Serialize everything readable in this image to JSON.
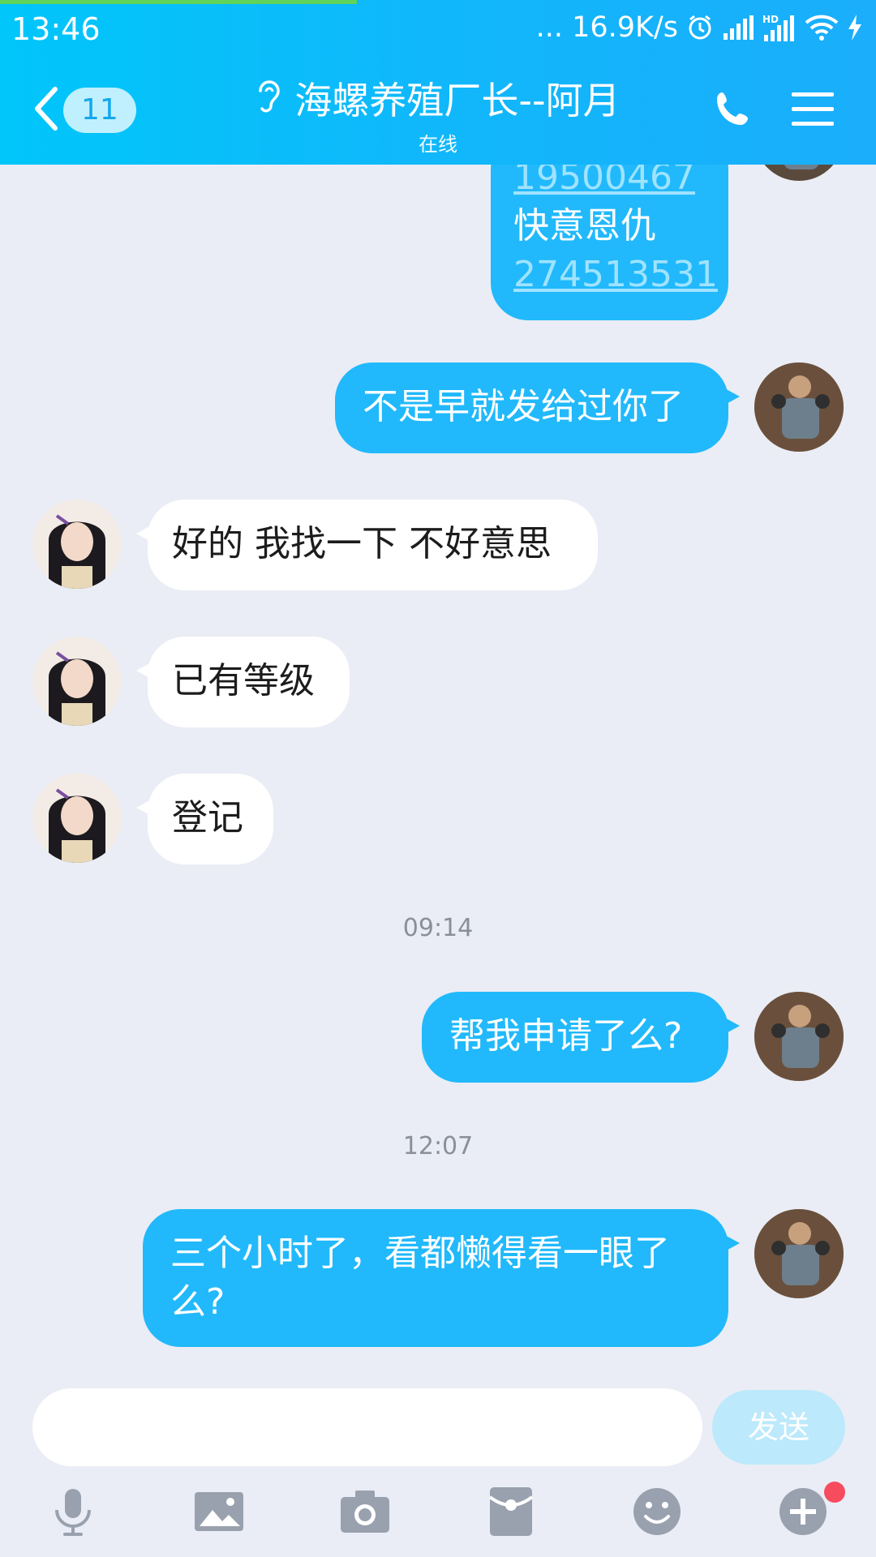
{
  "status_bar": {
    "time": "13:46",
    "network_speed": "... 16.9K/s",
    "icons": [
      "alarm-icon",
      "signal-icon",
      "hd-signal-icon",
      "wifi-icon",
      "charging-icon"
    ]
  },
  "header": {
    "back_count": "11",
    "title": "海螺养殖厂长--阿月",
    "subtitle": "在线",
    "icons": [
      "back-chevron-icon",
      "ear-icon",
      "phone-icon",
      "menu-icon"
    ]
  },
  "messages": [
    {
      "side": "out",
      "lines": [
        "19500467",
        "快意恩仇",
        "274513531"
      ]
    },
    {
      "side": "out",
      "text": "不是早就发给过你了"
    },
    {
      "side": "in",
      "text": "好的 我找一下 不好意思"
    },
    {
      "side": "in",
      "text": "已有等级"
    },
    {
      "side": "in",
      "text": "登记"
    },
    {
      "timestamp": "09:14"
    },
    {
      "side": "out",
      "text": "帮我申请了么?"
    },
    {
      "timestamp": "12:07"
    },
    {
      "side": "out",
      "text": "三个小时了，看都懒得看一眼了么?"
    }
  ],
  "composer": {
    "input_value": "",
    "send_label": "发送"
  },
  "toolbar": [
    "microphone-icon",
    "image-icon",
    "camera-icon",
    "red-packet-icon",
    "emoji-icon",
    "plus-icon"
  ],
  "colors": {
    "header_start": "#00c6fa",
    "header_end": "#1aaefb",
    "outgoing_bubble": "#21b9fb",
    "incoming_bubble": "#ffffff",
    "background": "#eaedf5",
    "notification_dot": "#f74c5e"
  }
}
